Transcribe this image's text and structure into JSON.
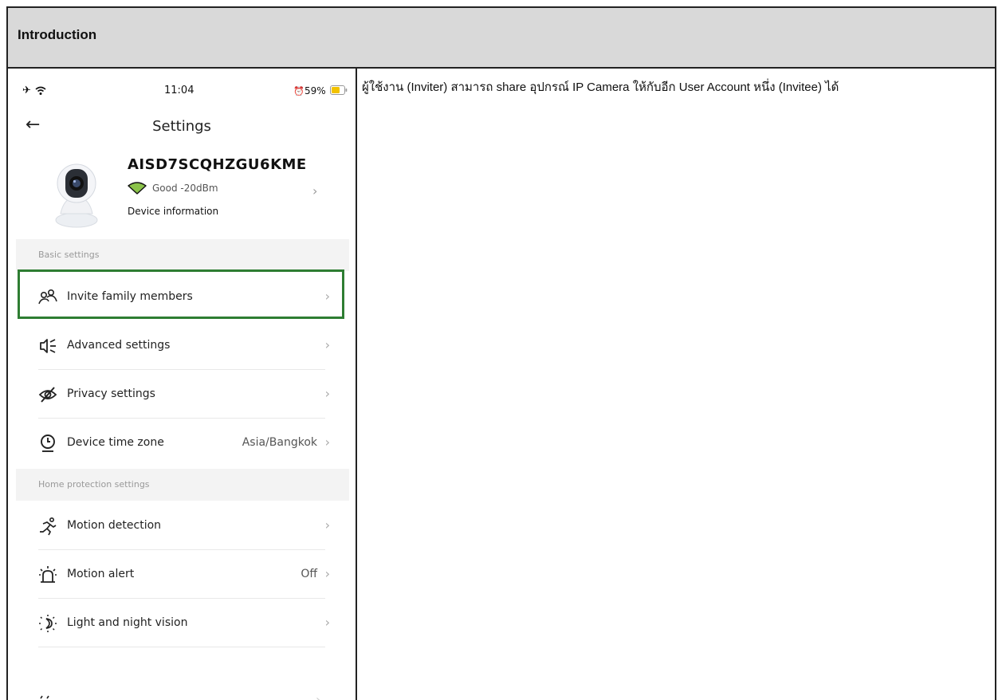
{
  "header": {
    "title": "Introduction"
  },
  "description": "ผู้ใช้งาน (Inviter) สามารถ share อุปกรณ์ IP Camera ให้กับอีก User Account หนึ่ง (Invitee) ได้",
  "phone": {
    "status_bar": {
      "time": "11:04",
      "battery": "59%"
    },
    "nav_title": "Settings",
    "device": {
      "name": "AISD7SCQHZGU6KME",
      "signal": "Good -20dBm",
      "info_label": "Device information"
    },
    "basic_section": "Basic settings",
    "basic_items": [
      {
        "label": "Invite family members",
        "value": "",
        "icon": "family-icon"
      },
      {
        "label": "Advanced settings",
        "value": "",
        "icon": "speaker-icon"
      },
      {
        "label": "Privacy settings",
        "value": "",
        "icon": "eye-off-icon"
      },
      {
        "label": "Device time zone",
        "value": "Asia/Bangkok",
        "icon": "clock-pin-icon"
      }
    ],
    "home_section": "Home protection settings",
    "home_items": [
      {
        "label": "Motion detection",
        "value": "",
        "icon": "running-icon"
      },
      {
        "label": "Motion alert",
        "value": "Off",
        "icon": "alarm-light-icon"
      },
      {
        "label": "Light and night vision",
        "value": "",
        "icon": "sun-moon-icon"
      }
    ],
    "highlight_color": "#2e7d32"
  }
}
